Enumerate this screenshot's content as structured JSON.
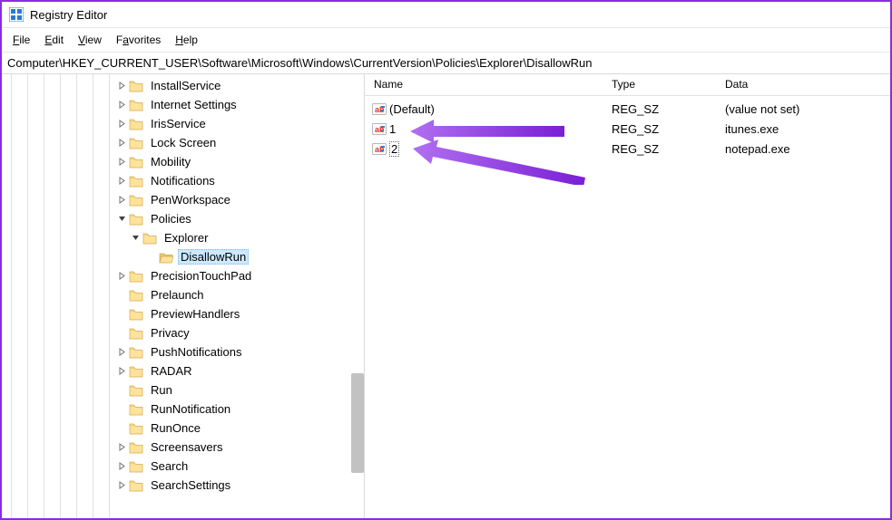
{
  "window": {
    "title": "Registry Editor"
  },
  "menu": {
    "file": "File",
    "edit": "Edit",
    "view": "View",
    "favorites": "Favorites",
    "help": "Help"
  },
  "address": "Computer\\HKEY_CURRENT_USER\\Software\\Microsoft\\Windows\\CurrentVersion\\Policies\\Explorer\\DisallowRun",
  "tree": {
    "items": [
      {
        "label": "InstallService",
        "expander": ">",
        "depth": 0
      },
      {
        "label": "Internet Settings",
        "expander": ">",
        "depth": 0
      },
      {
        "label": "IrisService",
        "expander": ">",
        "depth": 0
      },
      {
        "label": "Lock Screen",
        "expander": ">",
        "depth": 0
      },
      {
        "label": "Mobility",
        "expander": ">",
        "depth": 0
      },
      {
        "label": "Notifications",
        "expander": ">",
        "depth": 0
      },
      {
        "label": "PenWorkspace",
        "expander": ">",
        "depth": 0
      },
      {
        "label": "Policies",
        "expander": "v",
        "depth": 0
      },
      {
        "label": "Explorer",
        "expander": "v",
        "depth": 1
      },
      {
        "label": "DisallowRun",
        "expander": "",
        "depth": 2,
        "selected": true
      },
      {
        "label": "PrecisionTouchPad",
        "expander": ">",
        "depth": 0
      },
      {
        "label": "Prelaunch",
        "expander": "",
        "depth": 0
      },
      {
        "label": "PreviewHandlers",
        "expander": "",
        "depth": 0
      },
      {
        "label": "Privacy",
        "expander": "",
        "depth": 0
      },
      {
        "label": "PushNotifications",
        "expander": ">",
        "depth": 0
      },
      {
        "label": "RADAR",
        "expander": ">",
        "depth": 0
      },
      {
        "label": "Run",
        "expander": "",
        "depth": 0
      },
      {
        "label": "RunNotification",
        "expander": "",
        "depth": 0
      },
      {
        "label": "RunOnce",
        "expander": "",
        "depth": 0
      },
      {
        "label": "Screensavers",
        "expander": ">",
        "depth": 0
      },
      {
        "label": "Search",
        "expander": ">",
        "depth": 0
      },
      {
        "label": "SearchSettings",
        "expander": ">",
        "depth": 0
      }
    ]
  },
  "list": {
    "headers": {
      "name": "Name",
      "type": "Type",
      "data": "Data"
    },
    "rows": [
      {
        "name": "(Default)",
        "type": "REG_SZ",
        "data": "(value not set)",
        "editing": false
      },
      {
        "name": "1",
        "type": "REG_SZ",
        "data": "itunes.exe",
        "editing": false
      },
      {
        "name": "2",
        "type": "REG_SZ",
        "data": "notepad.exe",
        "editing": true
      }
    ]
  }
}
